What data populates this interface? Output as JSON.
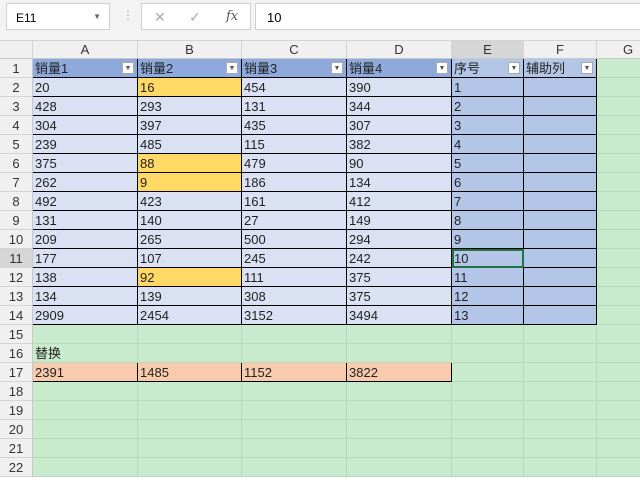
{
  "name_box": "E11",
  "formula": "10",
  "formula_icons": [
    "cancel-icon",
    "enter-icon",
    "fx-icon"
  ],
  "columns": [
    "A",
    "B",
    "C",
    "D",
    "E",
    "F",
    "G"
  ],
  "rows": [
    "1",
    "2",
    "3",
    "4",
    "5",
    "6",
    "7",
    "8",
    "9",
    "10",
    "11",
    "12",
    "13",
    "14",
    "15",
    "16",
    "17",
    "18",
    "19",
    "20",
    "21",
    "22"
  ],
  "headers": [
    "销量1",
    "销量2",
    "销量3",
    "销量4",
    "序号",
    "辅助列"
  ],
  "data": [
    [
      "20",
      "16",
      "454",
      "390",
      "1",
      ""
    ],
    [
      "428",
      "293",
      "131",
      "344",
      "2",
      ""
    ],
    [
      "304",
      "397",
      "435",
      "307",
      "3",
      ""
    ],
    [
      "239",
      "485",
      "115",
      "382",
      "4",
      ""
    ],
    [
      "375",
      "88",
      "479",
      "90",
      "5",
      ""
    ],
    [
      "262",
      "9",
      "186",
      "134",
      "6",
      ""
    ],
    [
      "492",
      "423",
      "161",
      "412",
      "7",
      ""
    ],
    [
      "131",
      "140",
      "27",
      "149",
      "8",
      ""
    ],
    [
      "209",
      "265",
      "500",
      "294",
      "9",
      ""
    ],
    [
      "177",
      "107",
      "245",
      "242",
      "10",
      ""
    ],
    [
      "138",
      "92",
      "111",
      "375",
      "11",
      ""
    ],
    [
      "134",
      "139",
      "308",
      "375",
      "12",
      ""
    ],
    [
      "2909",
      "2454",
      "3152",
      "3494",
      "13",
      ""
    ]
  ],
  "highlighted_b_rows": [
    2,
    6,
    7,
    12
  ],
  "label_row16": "替换",
  "row17": [
    "2391",
    "1485",
    "1152",
    "3822"
  ],
  "colors": {
    "header": "#8EA9DB",
    "header_light": "#B4C6E7",
    "body": "#D9E1F2",
    "body_light": "#B4C6E7",
    "yellow": "#FFD966",
    "orange": "#F8CBAD",
    "sheet_bg": "#C8EBCD"
  }
}
